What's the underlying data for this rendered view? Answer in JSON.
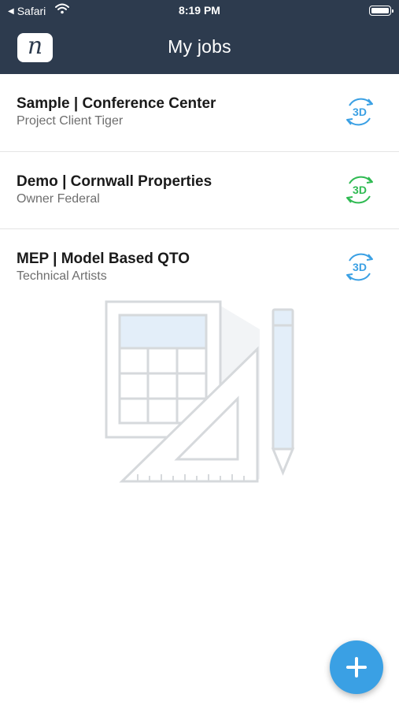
{
  "status_bar": {
    "back_app": "Safari",
    "time": "8:19 PM"
  },
  "header": {
    "logo_letter": "n",
    "title": "My jobs"
  },
  "jobs": [
    {
      "title": "Sample | Conference Center",
      "subtitle": "Project Client Tiger",
      "badge": "3D",
      "badge_color": "#3aa0e4"
    },
    {
      "title": "Demo | Cornwall Properties",
      "subtitle": "Owner Federal",
      "badge": "3D",
      "badge_color": "#2fba52"
    },
    {
      "title": "MEP | Model Based QTO",
      "subtitle": "Technical Artists",
      "badge": "3D",
      "badge_color": "#3aa0e4"
    }
  ],
  "colors": {
    "header_bg": "#2d3b4e",
    "fab": "#3aa0e4"
  },
  "icons": {
    "fab": "plus-icon",
    "badge": "3d-rotate-icon",
    "empty": "drafting-tools-illustration"
  }
}
